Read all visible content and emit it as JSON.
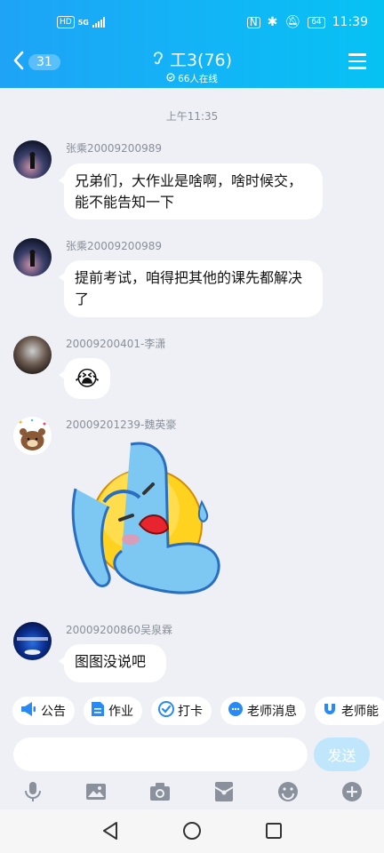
{
  "status_bar": {
    "hd": "HD",
    "net": "5G",
    "time": "11:39",
    "battery": "64"
  },
  "header": {
    "back_count": "31",
    "title": "工3(76)",
    "online": "66人在线"
  },
  "chat": {
    "time_separator": "上午11:35",
    "messages": [
      {
        "sender": "张乘20009200989",
        "text": "兄弟们，大作业是啥啊，啥时候交，能不能告知一下"
      },
      {
        "sender": "张乘20009200989",
        "text": "提前考试，咱得把其他的课先都解决了"
      },
      {
        "sender": "20009200401-李潇",
        "emoji": "😭"
      },
      {
        "sender": "20009201239-魏英豪",
        "sticker": "crying-face-sticker"
      },
      {
        "sender": "20009200860吴泉霖",
        "text": "图图没说吧"
      }
    ]
  },
  "quick_actions": [
    {
      "label": "公告",
      "icon": "megaphone-icon"
    },
    {
      "label": "作业",
      "icon": "document-icon"
    },
    {
      "label": "打卡",
      "icon": "check-icon"
    },
    {
      "label": "老师消息",
      "icon": "chat-icon"
    },
    {
      "label": "老师能",
      "icon": "magnet-icon"
    }
  ],
  "composer": {
    "placeholder": "",
    "send_label": "发送"
  },
  "colors": {
    "header_start": "#1ea3f6",
    "header_end": "#06c2f3",
    "background": "#eef0f5",
    "send_disabled": "#bfe6fb"
  }
}
